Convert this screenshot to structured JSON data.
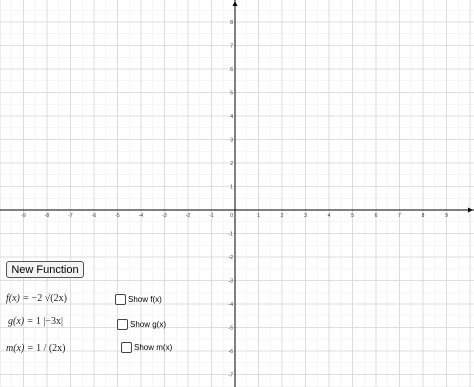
{
  "axes": {
    "x_ticks": [
      "-9",
      "-8",
      "-7",
      "-6",
      "-5",
      "-4",
      "-3",
      "-2",
      "-1",
      "0",
      "1",
      "2",
      "3",
      "4",
      "5",
      "6",
      "7",
      "8",
      "9"
    ],
    "y_ticks_pos": [
      "1",
      "2",
      "3",
      "4",
      "5",
      "6",
      "7",
      "8"
    ],
    "y_ticks_neg": [
      "-1",
      "-2",
      "-3",
      "-4",
      "-5",
      "-6",
      "-7"
    ]
  },
  "controls": {
    "new_function_label": "New Function",
    "functions": [
      {
        "name": "f(x) =",
        "expr": "−2 √(2x)",
        "checkbox_label": "Show f(x)",
        "checked": false
      },
      {
        "name": "g(x) =",
        "expr": "1 |−3x|",
        "checkbox_label": "Show g(x)",
        "checked": false
      },
      {
        "name": "m(x) =",
        "expr": "1 / (2x)",
        "checkbox_label": "Show m(x)",
        "checked": false
      }
    ]
  },
  "colors": {
    "grid": "#d6d6d6",
    "axis": "#000000",
    "background": "#ffffff"
  }
}
